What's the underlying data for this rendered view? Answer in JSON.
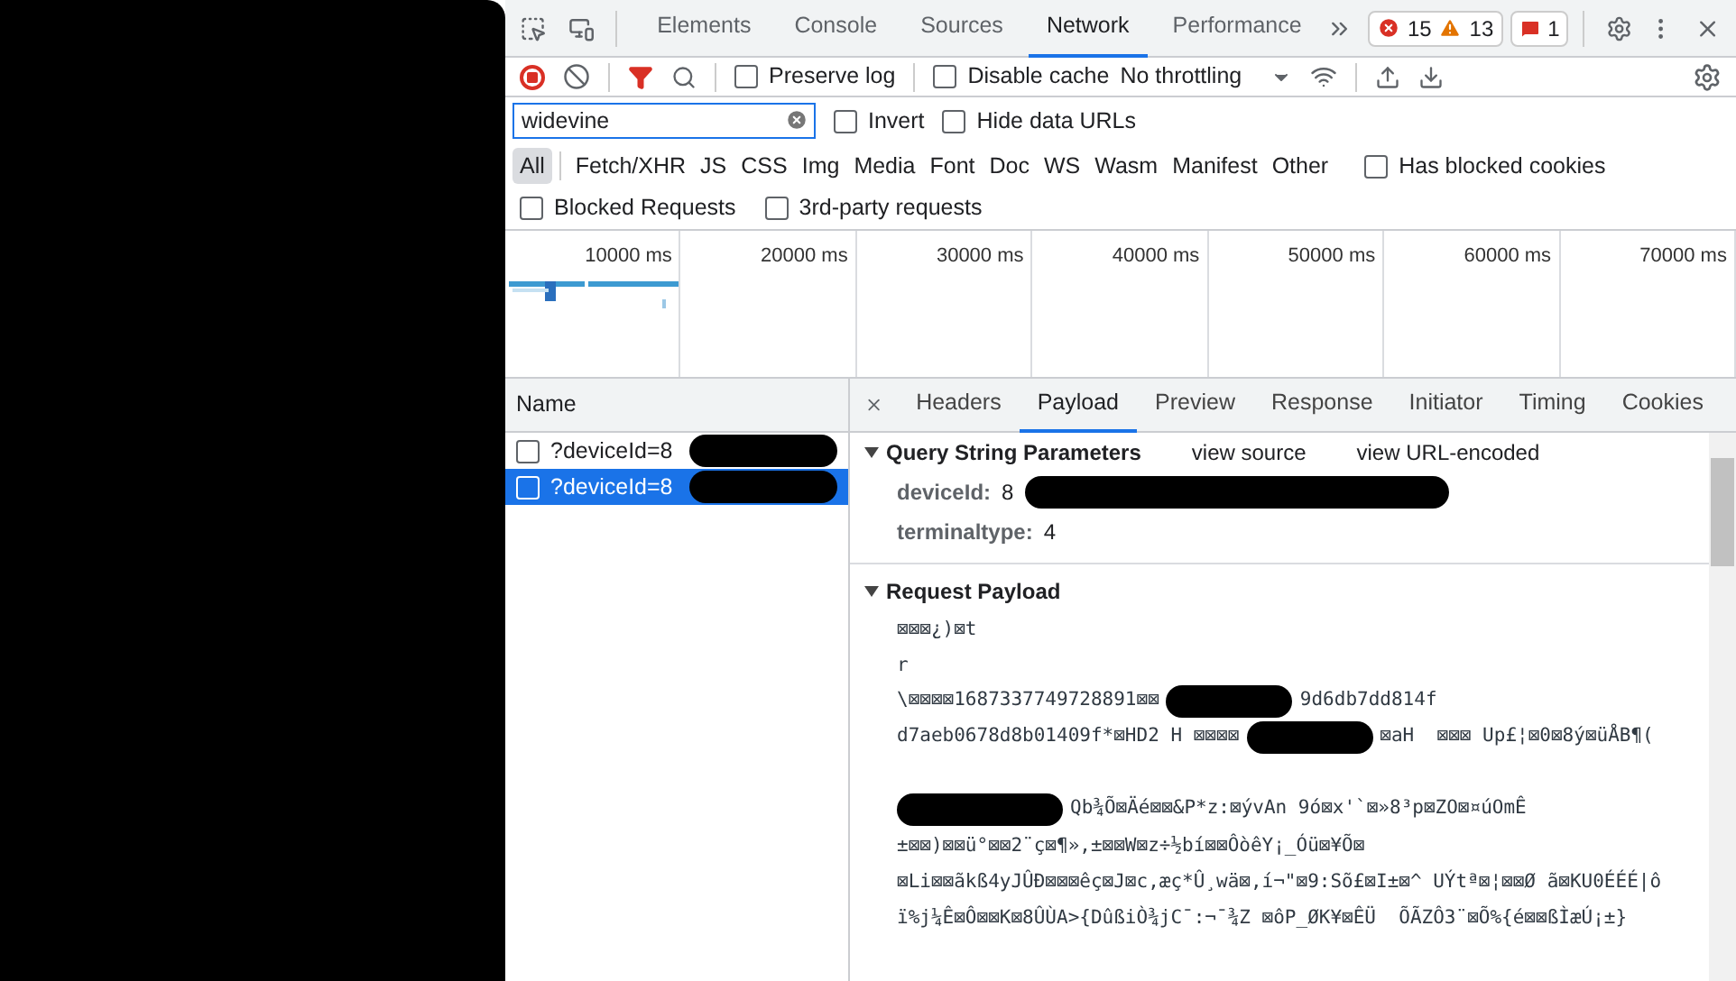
{
  "devtools_tabs": [
    {
      "label": "Elements",
      "selected": false
    },
    {
      "label": "Console",
      "selected": false
    },
    {
      "label": "Sources",
      "selected": false
    },
    {
      "label": "Network",
      "selected": true
    },
    {
      "label": "Performance",
      "selected": false
    }
  ],
  "issues": {
    "errors": "15",
    "warnings": "13",
    "messages": "1"
  },
  "toolbar": {
    "recording": true,
    "preserve_log": {
      "label": "Preserve log",
      "checked": false
    },
    "disable_cache": {
      "label": "Disable cache",
      "checked": false
    },
    "throttling": "No throttling"
  },
  "filter": {
    "value": "widevine",
    "invert": {
      "label": "Invert",
      "checked": false
    },
    "hide_data_urls": {
      "label": "Hide data URLs",
      "checked": false
    }
  },
  "type_filters": [
    {
      "label": "All",
      "selected": true
    },
    {
      "label": "Fetch/XHR",
      "selected": false
    },
    {
      "label": "JS",
      "selected": false
    },
    {
      "label": "CSS",
      "selected": false
    },
    {
      "label": "Img",
      "selected": false
    },
    {
      "label": "Media",
      "selected": false
    },
    {
      "label": "Font",
      "selected": false
    },
    {
      "label": "Doc",
      "selected": false
    },
    {
      "label": "WS",
      "selected": false
    },
    {
      "label": "Wasm",
      "selected": false
    },
    {
      "label": "Manifest",
      "selected": false
    },
    {
      "label": "Other",
      "selected": false
    }
  ],
  "has_blocked_cookies": {
    "label": "Has blocked cookies",
    "checked": false
  },
  "extra_filters": [
    {
      "label": "Blocked Requests",
      "checked": false
    },
    {
      "label": "3rd-party requests",
      "checked": false
    }
  ],
  "timeline": {
    "ticks": [
      "10000 ms",
      "20000 ms",
      "30000 ms",
      "40000 ms",
      "50000 ms",
      "60000 ms",
      "70000 ms"
    ]
  },
  "requests": {
    "column": "Name",
    "rows": [
      {
        "name": "?deviceId=8",
        "selected": false,
        "checked": false
      },
      {
        "name": "?deviceId=8",
        "selected": true,
        "checked": false
      }
    ]
  },
  "detail_tabs": [
    {
      "label": "Headers",
      "selected": false
    },
    {
      "label": "Payload",
      "selected": true
    },
    {
      "label": "Preview",
      "selected": false
    },
    {
      "label": "Response",
      "selected": false
    },
    {
      "label": "Initiator",
      "selected": false
    },
    {
      "label": "Timing",
      "selected": false
    },
    {
      "label": "Cookies",
      "selected": false
    }
  ],
  "query_section": {
    "title": "Query String Parameters",
    "expanded": true,
    "links": [
      "view source",
      "view URL-encoded"
    ],
    "params": [
      {
        "key": "deviceId:",
        "value": "8",
        "redacted": true
      },
      {
        "key": "terminaltype:",
        "value": "4",
        "redacted": false
      }
    ]
  },
  "payload_section": {
    "title": "Request Payload",
    "expanded": true,
    "lines": [
      {
        "kind": "text",
        "text": "⊠⊠⊠¿)⊠t"
      },
      {
        "kind": "text",
        "text": "r"
      },
      {
        "kind": "redacted",
        "before": "\\⊠⊠⊠⊠1687337749728891⊠⊠",
        "after": "9d6db7dd814f"
      },
      {
        "kind": "redacted",
        "before": "d7aeb0678d8b01409f*⊠HD2 H ⊠⊠⊠⊠",
        "after": "⊠aH  ⊠⊠⊠ Up£¦⊠0⊠8ý⊠üÅB¶("
      },
      {
        "kind": "blank"
      },
      {
        "kind": "redacted",
        "after": "Qb¾Õ⊠Äé⊠⊠&P*z:⊠ývAn 9ó⊠x'`⊠»8³p⊠ZO⊠¤úOmÊ"
      },
      {
        "kind": "text",
        "text": "±⊠⊠)⊠⊠ü°⊠⊠2¨ç⊠¶»,±⊠⊠W⊠z÷½bí⊠⊠ÔòêY¡_Óü⊠¥Õ⊠"
      },
      {
        "kind": "text",
        "text": "⊠Li⊠⊠ãkß4yJÛÐ⊠⊠⊠êç⊠J⊠c,æç*Û¸wä⊠,í¬\"⊠9:Sõ£⊠I±⊠^ UÝtª⊠¦⊠⊠Ø ã⊠KU0ÉÉÉ|ô"
      },
      {
        "kind": "text",
        "text": "ï%j¼Ê⊠Ô⊠⊠K⊠8ÛÙA>{DûßiÒ¾jC¯:¬¯¾Z ⊠ôP_ØK¥⊠ÊÜ  ÕÃZÔ3¨⊠Õ%{é⊠⊠ßÌæÚ¡±}"
      }
    ]
  }
}
